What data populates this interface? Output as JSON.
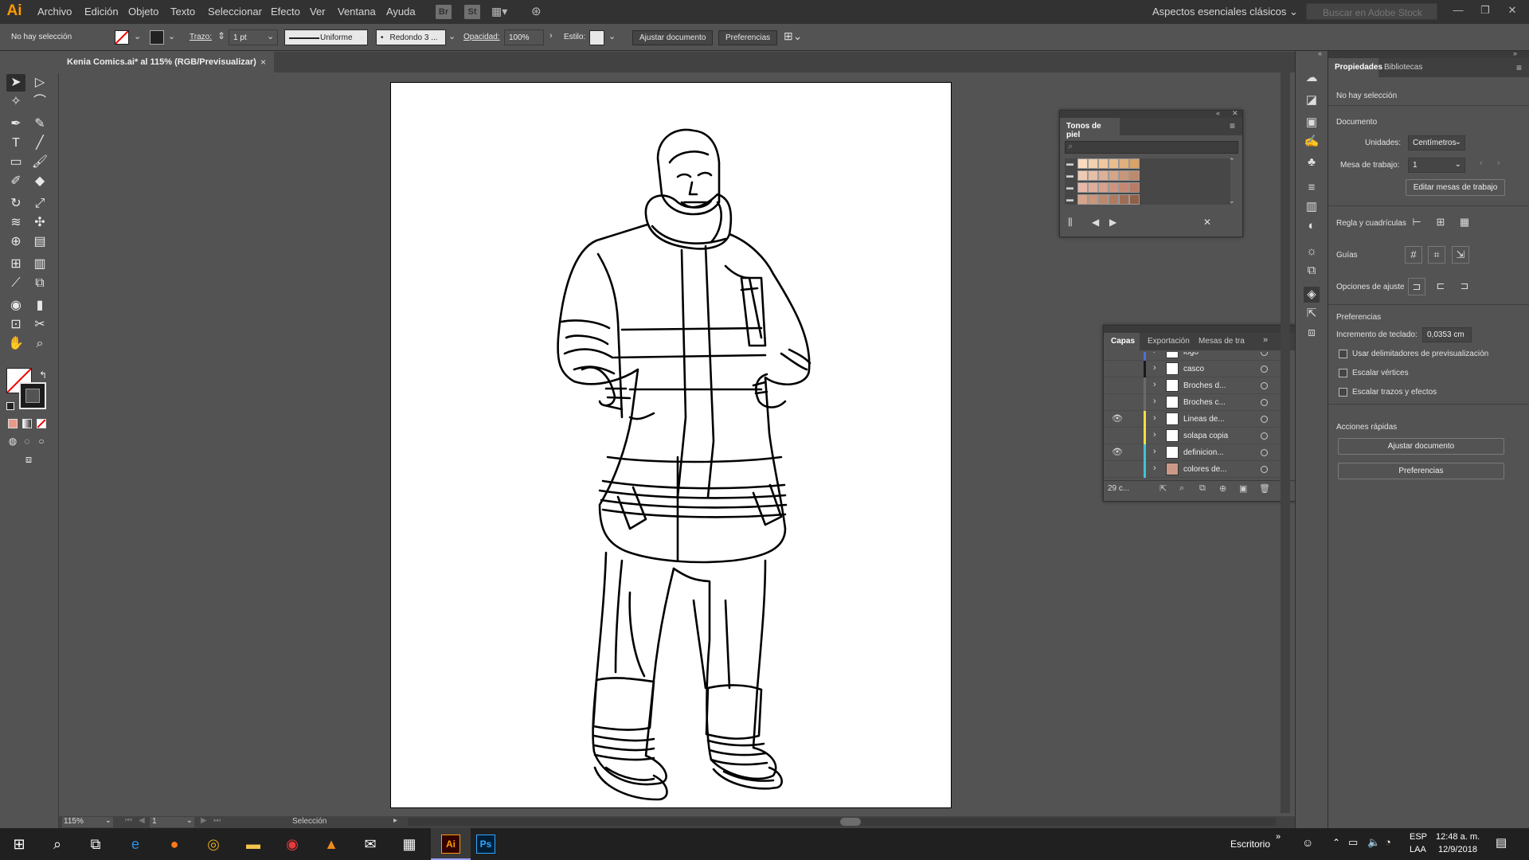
{
  "menubar": {
    "logo": "Ai",
    "items": [
      "Archivo",
      "Edición",
      "Objeto",
      "Texto",
      "Seleccionar",
      "Efecto",
      "Ver",
      "Ventana",
      "Ayuda"
    ],
    "bridge": "Br",
    "stock": "St",
    "workspace": "Aspectos esenciales clásicos",
    "stock_search_placeholder": "Buscar en Adobe Stock"
  },
  "controlbar": {
    "selection": "No hay selección",
    "stroke_label": "Trazo:",
    "stroke_value": "1 pt",
    "profile": "Uniforme",
    "brush": "Redondo 3 ...",
    "opacity_label": "Opacidad:",
    "opacity_value": "100%",
    "style_label": "Estilo:",
    "fit_button": "Ajustar documento",
    "prefs_button": "Preferencias"
  },
  "document_tab": {
    "title": "Kenia Comics.ai* al 115% (RGB/Previsualizar)",
    "close": "×"
  },
  "skin_panel": {
    "title": "Tonos de piel",
    "swatch_rows": [
      [
        "#f9dcc0",
        "#f3d0ae",
        "#f0c79f",
        "#e9bd8e",
        "#e0b07c",
        "#d7a367"
      ],
      [
        "#efcbb4",
        "#e7bfa6",
        "#ddb197",
        "#d4a588",
        "#c89679",
        "#bc8a6d"
      ],
      [
        "#e8b8a8",
        "#e1ad9b",
        "#d9a08c",
        "#cf937d",
        "#c5876f",
        "#b87b63"
      ],
      [
        "#d6a48a",
        "#c9967b",
        "#bc886d",
        "#ae7a60",
        "#9f6d53",
        "#8f6048"
      ]
    ]
  },
  "layers_panel": {
    "tabs": [
      "Capas",
      "Exportación",
      "Mesas de tra"
    ],
    "layers": [
      {
        "name": "logo",
        "color": "#4f6fd8",
        "visible": false
      },
      {
        "name": "casco",
        "color": "#1a1a1a",
        "visible": false
      },
      {
        "name": "Broches d...",
        "color": "#6a6a6a",
        "visible": false
      },
      {
        "name": "Broches c...",
        "color": "#6a6a6a",
        "visible": false
      },
      {
        "name": "Lineas de...",
        "color": "#f0e040",
        "visible": true
      },
      {
        "name": "solapa copia",
        "color": "#f0e040",
        "visible": false
      },
      {
        "name": "definicion...",
        "color": "#3ec4d8",
        "visible": true
      },
      {
        "name": "colores de...",
        "color": "#3ec4d8",
        "visible": false
      }
    ],
    "count": "29 c..."
  },
  "properties": {
    "tabs": [
      "Propiedades",
      "Bibliotecas"
    ],
    "no_selection": "No hay selección",
    "document_heading": "Documento",
    "units_label": "Unidades:",
    "units_value": "Centímetros",
    "artboard_label": "Mesa de trabajo:",
    "artboard_value": "1",
    "edit_artboards": "Editar mesas de trabajo",
    "rulers_label": "Regla y cuadrículas",
    "guides_label": "Guías",
    "snap_label": "Opciones de ajuste",
    "prefs_heading": "Preferencias",
    "keyboard_inc_label": "Incremento de teclado:",
    "keyboard_inc_value": "0,0353 cm",
    "chk_preview_bounds": "Usar delimitadores de previsualización",
    "chk_scale_corners": "Escalar vértices",
    "chk_scale_strokes": "Escalar trazos y efectos",
    "quick_actions": "Acciones rápidas",
    "fit_document": "Ajustar documento",
    "preferences": "Preferencias"
  },
  "statusbar": {
    "zoom": "115%",
    "artboard": "1",
    "tool": "Selección"
  },
  "taskbar": {
    "desktop": "Escritorio",
    "lang": "ESP",
    "lang2": "LAA",
    "time": "12:48 a. m.",
    "date": "12/9/2018",
    "ai_label": "Ai",
    "ps_label": "Ps"
  }
}
